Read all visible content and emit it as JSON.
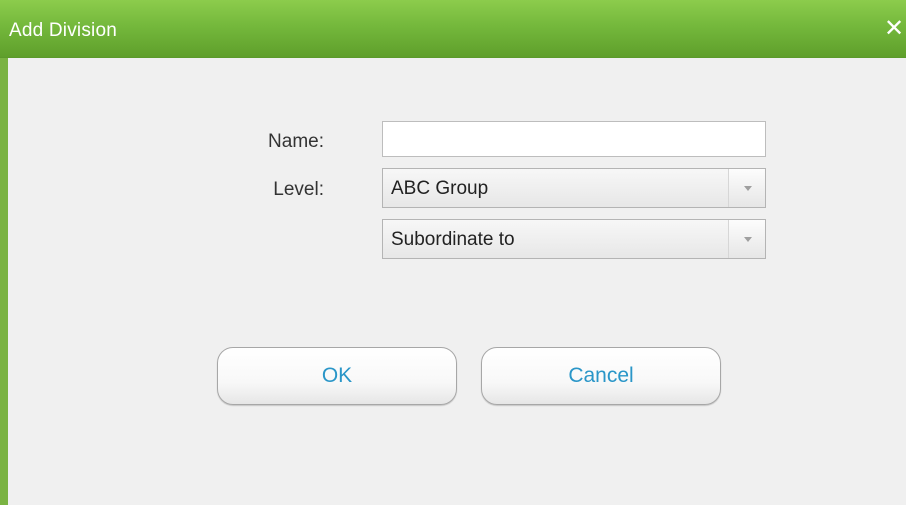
{
  "dialog": {
    "title": "Add Division",
    "close_icon": "close-icon",
    "close_symbol": "✕"
  },
  "form": {
    "name_label": "Name:",
    "name_value": "",
    "level_label": "Level:",
    "level_selected": "ABC Group",
    "subordinate_selected": "Subordinate to"
  },
  "actions": {
    "ok_label": "OK",
    "cancel_label": "Cancel"
  },
  "colors": {
    "titlebar": "#73b73b",
    "button_text": "#2a96c8"
  }
}
